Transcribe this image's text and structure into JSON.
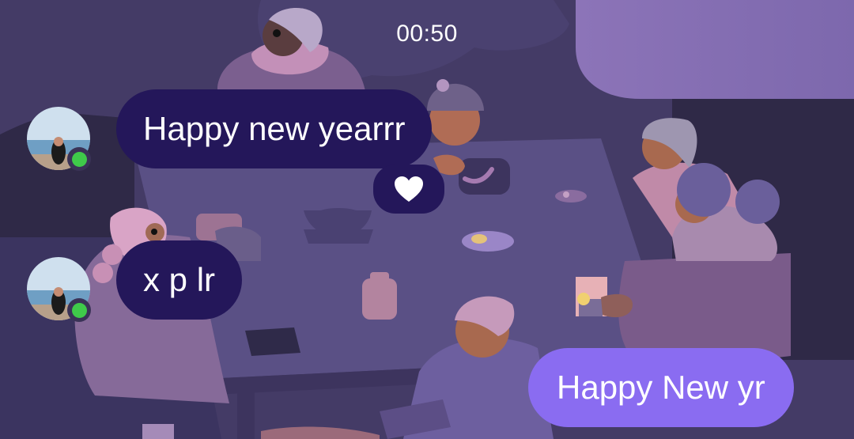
{
  "chat": {
    "timestamp": "00:50",
    "messages": [
      {
        "direction": "incoming",
        "text": "Happy new yearrr",
        "reaction": "heart-icon"
      },
      {
        "direction": "incoming",
        "text": "x p lr"
      },
      {
        "direction": "outgoing",
        "text": "Happy New yr"
      }
    ]
  },
  "colors": {
    "incoming_bubble": "#24175a",
    "outgoing_bubble": "#8a6cf1",
    "online_indicator": "#3fca4a"
  }
}
